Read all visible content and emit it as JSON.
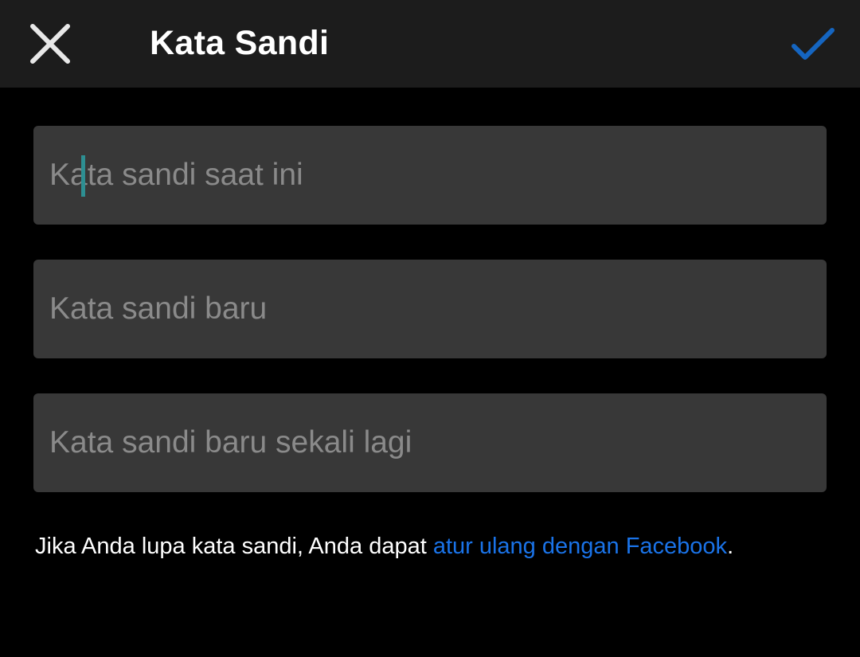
{
  "appbar": {
    "title": "Kata Sandi",
    "close_icon": "close-icon",
    "confirm_icon": "check-icon",
    "confirm_color": "#1565c0"
  },
  "fields": {
    "current_password": {
      "placeholder": "Kata sandi saat ini",
      "value": ""
    },
    "new_password": {
      "placeholder": "Kata sandi baru",
      "value": ""
    },
    "confirm_password": {
      "placeholder": "Kata sandi baru sekali lagi",
      "value": ""
    }
  },
  "helper": {
    "text": "Jika Anda lupa kata sandi, Anda dapat ",
    "link_text": "atur ulang dengan Facebook",
    "suffix": "."
  },
  "colors": {
    "background": "#000000",
    "appbar": "#1c1c1c",
    "field": "#383838",
    "link": "#1a73e8",
    "cursor": "#2d8f92"
  }
}
